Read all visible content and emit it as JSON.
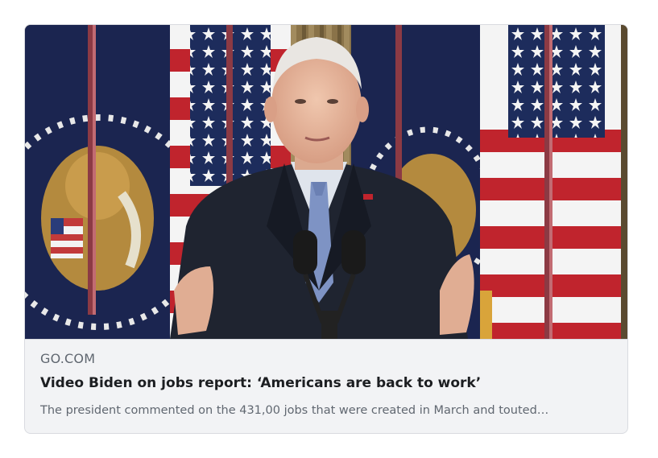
{
  "link_preview": {
    "domain": "GO.COM",
    "title": "Video Biden on jobs report: ‘Americans are back to work’",
    "description": "The president commented on the 431,00 jobs that were created in March and touted…",
    "image_subject": "president-at-podium"
  },
  "colors": {
    "card_background": "#f2f3f5",
    "card_border": "#d9dbe0",
    "title_text": "#1c1e21",
    "secondary_text": "#606770"
  }
}
